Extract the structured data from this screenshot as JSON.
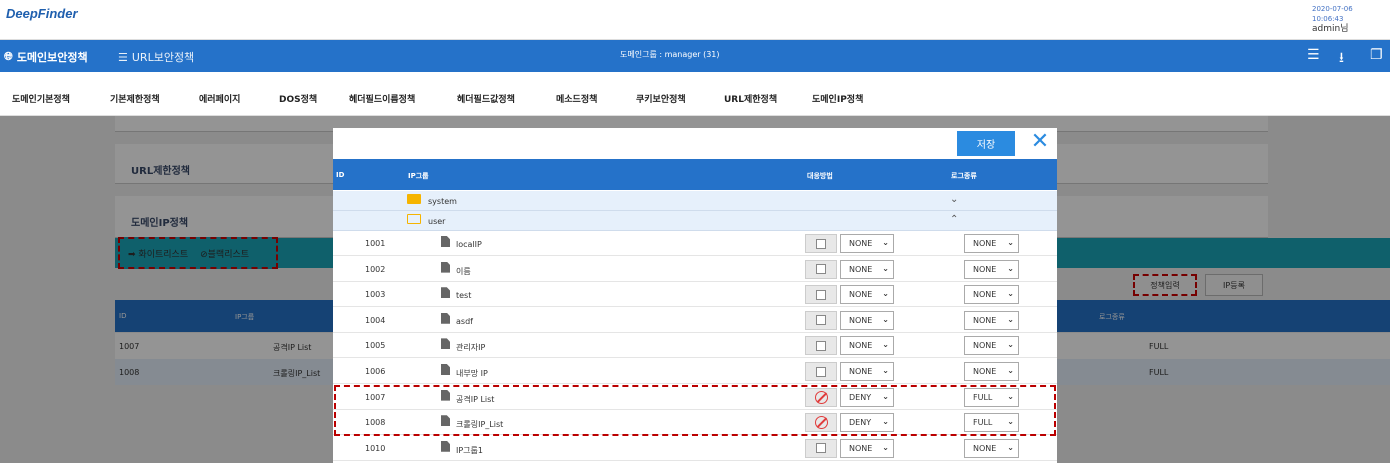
{
  "app": {
    "logo": "DeepFinder",
    "datetime": "2020-07-06",
    "time": "10:06:43",
    "user": "admin님"
  },
  "mainnav": {
    "domain_policy": "도메인보안정책",
    "url_policy": "URL보안정책",
    "domain_group": "도메인그룹 : manager (31)"
  },
  "subtabs": [
    "도메인기본정책",
    "기본제한정책",
    "에러페이지",
    "DOS정책",
    "헤더필드이름정책",
    "헤더필드값정책",
    "메소드정책",
    "쿠키보안정책",
    "URL제한정책",
    "도메인IP정책"
  ],
  "background": {
    "cards": [
      "URL제한정책",
      "도메인IP정책"
    ],
    "whitelist": "화이트리스트",
    "blacklist": "블랙리스트",
    "policy_input": "정책입력",
    "ip_register": "IP등록",
    "table_headers": [
      "ID",
      "IP그룹",
      "로그종류"
    ],
    "rows": [
      {
        "id": "1007",
        "name": "공격IP List",
        "log": "FULL"
      },
      {
        "id": "1008",
        "name": "크롤링IP_List",
        "log": "FULL"
      }
    ]
  },
  "modal": {
    "save_label": "저장",
    "headers": {
      "id": "ID",
      "group": "IP그룹",
      "action": "대응방법",
      "log": "로그종류"
    },
    "groups": [
      {
        "name": "system"
      },
      {
        "name": "user"
      }
    ],
    "rows": [
      {
        "id": "1001",
        "name": "localIP",
        "action": "NONE",
        "log": "NONE",
        "deny": false
      },
      {
        "id": "1002",
        "name": "이름",
        "action": "NONE",
        "log": "NONE",
        "deny": false
      },
      {
        "id": "1003",
        "name": "test",
        "action": "NONE",
        "log": "NONE",
        "deny": false
      },
      {
        "id": "1004",
        "name": "asdf",
        "action": "NONE",
        "log": "NONE",
        "deny": false
      },
      {
        "id": "1005",
        "name": "관리자IP",
        "action": "NONE",
        "log": "NONE",
        "deny": false
      },
      {
        "id": "1006",
        "name": "내부망 IP",
        "action": "NONE",
        "log": "NONE",
        "deny": false
      },
      {
        "id": "1007",
        "name": "공격IP List",
        "action": "DENY",
        "log": "FULL",
        "deny": true
      },
      {
        "id": "1008",
        "name": "크롤링IP_List",
        "action": "DENY",
        "log": "FULL",
        "deny": true
      },
      {
        "id": "1010",
        "name": "IP그룹1",
        "action": "NONE",
        "log": "NONE",
        "deny": false
      }
    ]
  },
  "colors": {
    "primary": "#2572c9",
    "teal": "#1aa5b8",
    "save": "#2b8be0",
    "deny": "#e03b3b",
    "highlight": "#b00000"
  }
}
